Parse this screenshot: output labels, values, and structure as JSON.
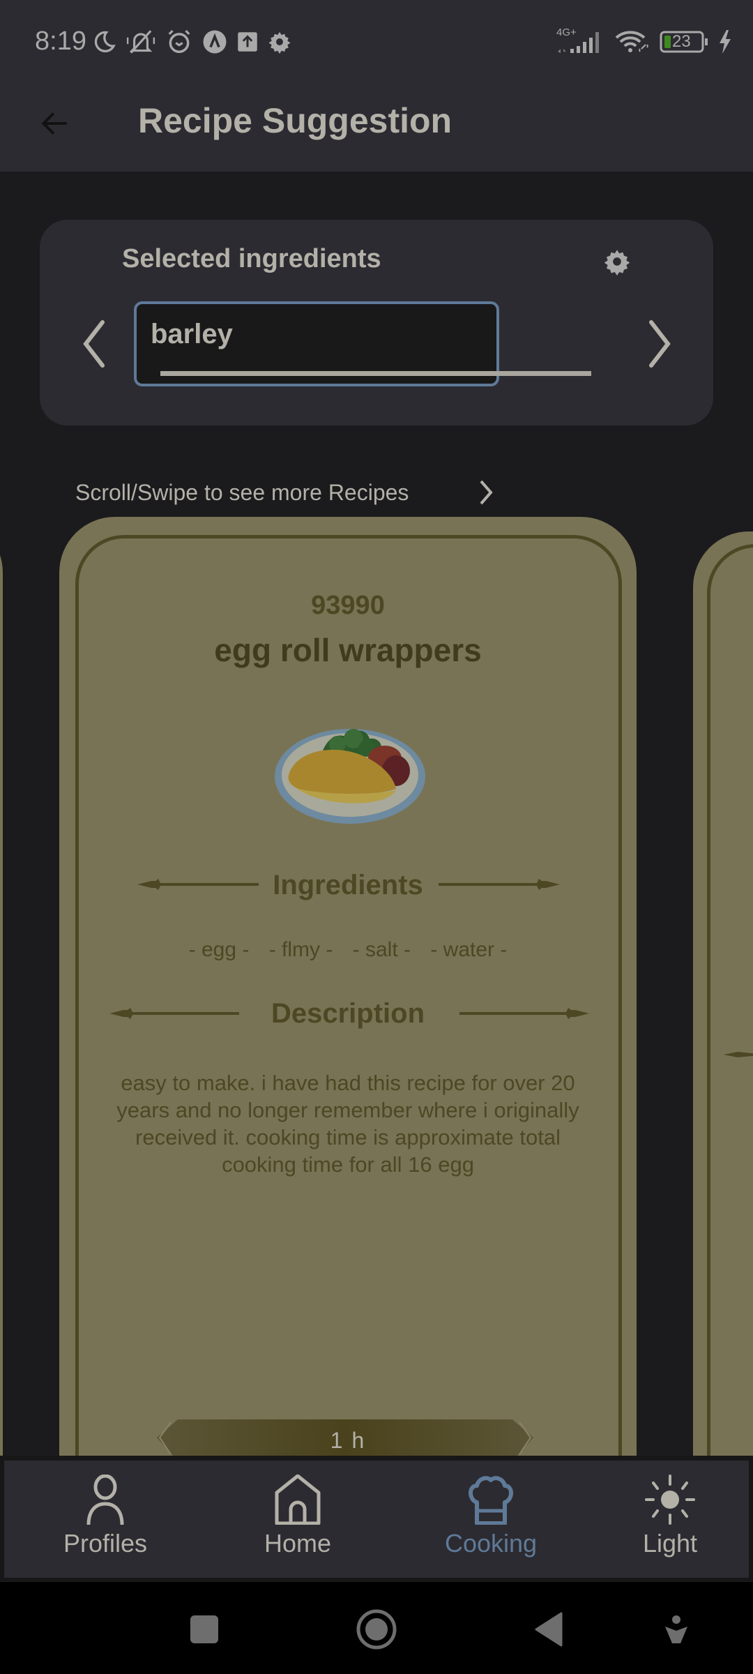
{
  "status_bar": {
    "time": "8:19",
    "left_icons": [
      "moon-icon",
      "bell-off-icon",
      "alarm-icon",
      "app-a-icon",
      "upload-icon",
      "gear-icon"
    ],
    "network": "4G+",
    "battery_level": "23",
    "battery_color": "#3f8a1e",
    "charging": true
  },
  "app_bar": {
    "title": "Recipe Suggestion",
    "back_icon": "arrow-left-icon"
  },
  "ingredients_panel": {
    "label": "Selected ingredients",
    "current_ingredient": "barley",
    "accent": "#5f7a98"
  },
  "scroll_hint": "Scroll/Swipe to see more Recipes",
  "recipe_card": {
    "id": "93990",
    "title": "egg roll wrappers",
    "image": "omelette-plate-image",
    "ingredients_heading": "Ingredients",
    "ingredients": [
      "- egg -",
      "- flmy -",
      "- salt -",
      "- water -"
    ],
    "description_heading": "Description",
    "description": "easy to make. i have had this recipe for over 20 years and no longer remember where i originally received it. cooking time is approximate total cooking time for all 16 egg",
    "time": "1 h",
    "card_color": "#797355",
    "text_color": "#4d4724"
  },
  "bottom_nav": {
    "items": [
      {
        "label": "Profiles",
        "icon": "person-icon",
        "active": false
      },
      {
        "label": "Home",
        "icon": "home-icon",
        "active": false
      },
      {
        "label": "Cooking",
        "icon": "chef-hat-icon",
        "active": true
      },
      {
        "label": "Light",
        "icon": "sun-icon",
        "active": false
      }
    ],
    "active_color": "#5f7a98"
  },
  "system_nav": [
    "recents-button",
    "home-button",
    "back-button",
    "accessibility-button"
  ]
}
